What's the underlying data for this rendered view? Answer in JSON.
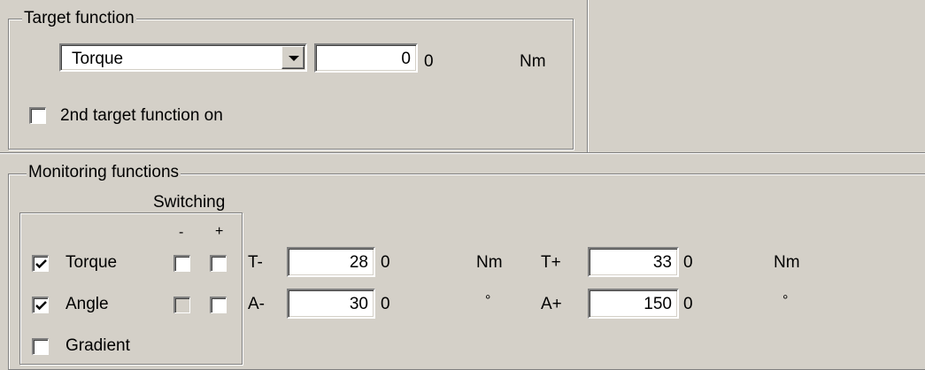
{
  "target_function": {
    "group_title": "Target function",
    "dropdown_value": "Torque",
    "value": "0",
    "value_suffix": "0",
    "unit": "Nm",
    "second_target_label": "2nd target function on",
    "second_target_checked": false
  },
  "monitoring": {
    "group_title": "Monitoring functions",
    "switching_label": "Switching",
    "minus_label": "-",
    "plus_label": "+",
    "rows": [
      {
        "name": "Torque",
        "checked": true,
        "switch_minus": false,
        "switch_plus": false,
        "switch_enabled": true,
        "lower_label": "T-",
        "lower_value": "28",
        "lower_suffix": "0",
        "lower_unit": "Nm",
        "upper_label": "T+",
        "upper_value": "33",
        "upper_suffix": "0",
        "upper_unit": "Nm"
      },
      {
        "name": "Angle",
        "checked": true,
        "switch_minus": false,
        "switch_plus": false,
        "switch_enabled": false,
        "lower_label": "A-",
        "lower_value": "30",
        "lower_suffix": "0",
        "lower_unit": "°",
        "upper_label": "A+",
        "upper_value": "150",
        "upper_suffix": "0",
        "upper_unit": "°"
      },
      {
        "name": "Gradient",
        "checked": false
      }
    ]
  }
}
